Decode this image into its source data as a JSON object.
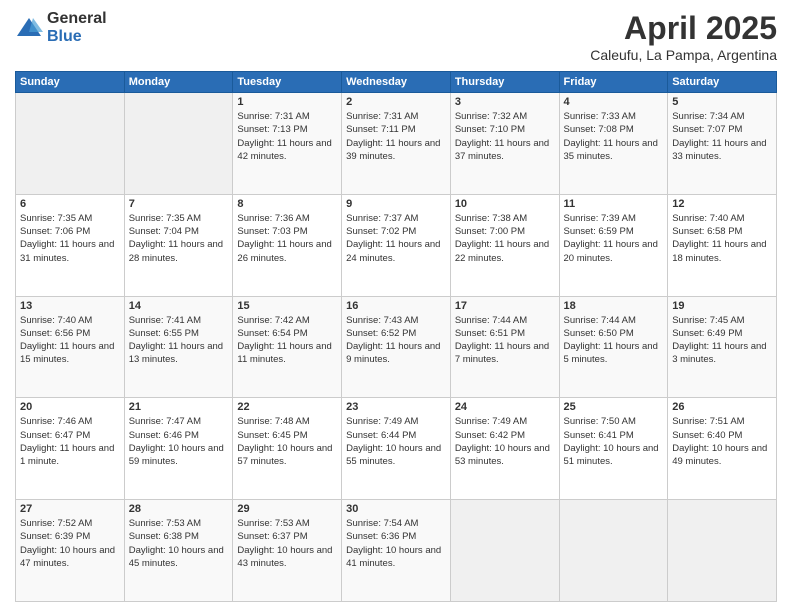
{
  "logo": {
    "general": "General",
    "blue": "Blue"
  },
  "header": {
    "month": "April 2025",
    "location": "Caleufu, La Pampa, Argentina"
  },
  "weekdays": [
    "Sunday",
    "Monday",
    "Tuesday",
    "Wednesday",
    "Thursday",
    "Friday",
    "Saturday"
  ],
  "weeks": [
    [
      null,
      null,
      {
        "day": 1,
        "sunrise": "7:31 AM",
        "sunset": "7:13 PM",
        "daylight": "11 hours and 42 minutes."
      },
      {
        "day": 2,
        "sunrise": "7:31 AM",
        "sunset": "7:11 PM",
        "daylight": "11 hours and 39 minutes."
      },
      {
        "day": 3,
        "sunrise": "7:32 AM",
        "sunset": "7:10 PM",
        "daylight": "11 hours and 37 minutes."
      },
      {
        "day": 4,
        "sunrise": "7:33 AM",
        "sunset": "7:08 PM",
        "daylight": "11 hours and 35 minutes."
      },
      {
        "day": 5,
        "sunrise": "7:34 AM",
        "sunset": "7:07 PM",
        "daylight": "11 hours and 33 minutes."
      }
    ],
    [
      {
        "day": 6,
        "sunrise": "7:35 AM",
        "sunset": "7:06 PM",
        "daylight": "11 hours and 31 minutes."
      },
      {
        "day": 7,
        "sunrise": "7:35 AM",
        "sunset": "7:04 PM",
        "daylight": "11 hours and 28 minutes."
      },
      {
        "day": 8,
        "sunrise": "7:36 AM",
        "sunset": "7:03 PM",
        "daylight": "11 hours and 26 minutes."
      },
      {
        "day": 9,
        "sunrise": "7:37 AM",
        "sunset": "7:02 PM",
        "daylight": "11 hours and 24 minutes."
      },
      {
        "day": 10,
        "sunrise": "7:38 AM",
        "sunset": "7:00 PM",
        "daylight": "11 hours and 22 minutes."
      },
      {
        "day": 11,
        "sunrise": "7:39 AM",
        "sunset": "6:59 PM",
        "daylight": "11 hours and 20 minutes."
      },
      {
        "day": 12,
        "sunrise": "7:40 AM",
        "sunset": "6:58 PM",
        "daylight": "11 hours and 18 minutes."
      }
    ],
    [
      {
        "day": 13,
        "sunrise": "7:40 AM",
        "sunset": "6:56 PM",
        "daylight": "11 hours and 15 minutes."
      },
      {
        "day": 14,
        "sunrise": "7:41 AM",
        "sunset": "6:55 PM",
        "daylight": "11 hours and 13 minutes."
      },
      {
        "day": 15,
        "sunrise": "7:42 AM",
        "sunset": "6:54 PM",
        "daylight": "11 hours and 11 minutes."
      },
      {
        "day": 16,
        "sunrise": "7:43 AM",
        "sunset": "6:52 PM",
        "daylight": "11 hours and 9 minutes."
      },
      {
        "day": 17,
        "sunrise": "7:44 AM",
        "sunset": "6:51 PM",
        "daylight": "11 hours and 7 minutes."
      },
      {
        "day": 18,
        "sunrise": "7:44 AM",
        "sunset": "6:50 PM",
        "daylight": "11 hours and 5 minutes."
      },
      {
        "day": 19,
        "sunrise": "7:45 AM",
        "sunset": "6:49 PM",
        "daylight": "11 hours and 3 minutes."
      }
    ],
    [
      {
        "day": 20,
        "sunrise": "7:46 AM",
        "sunset": "6:47 PM",
        "daylight": "11 hours and 1 minute."
      },
      {
        "day": 21,
        "sunrise": "7:47 AM",
        "sunset": "6:46 PM",
        "daylight": "10 hours and 59 minutes."
      },
      {
        "day": 22,
        "sunrise": "7:48 AM",
        "sunset": "6:45 PM",
        "daylight": "10 hours and 57 minutes."
      },
      {
        "day": 23,
        "sunrise": "7:49 AM",
        "sunset": "6:44 PM",
        "daylight": "10 hours and 55 minutes."
      },
      {
        "day": 24,
        "sunrise": "7:49 AM",
        "sunset": "6:42 PM",
        "daylight": "10 hours and 53 minutes."
      },
      {
        "day": 25,
        "sunrise": "7:50 AM",
        "sunset": "6:41 PM",
        "daylight": "10 hours and 51 minutes."
      },
      {
        "day": 26,
        "sunrise": "7:51 AM",
        "sunset": "6:40 PM",
        "daylight": "10 hours and 49 minutes."
      }
    ],
    [
      {
        "day": 27,
        "sunrise": "7:52 AM",
        "sunset": "6:39 PM",
        "daylight": "10 hours and 47 minutes."
      },
      {
        "day": 28,
        "sunrise": "7:53 AM",
        "sunset": "6:38 PM",
        "daylight": "10 hours and 45 minutes."
      },
      {
        "day": 29,
        "sunrise": "7:53 AM",
        "sunset": "6:37 PM",
        "daylight": "10 hours and 43 minutes."
      },
      {
        "day": 30,
        "sunrise": "7:54 AM",
        "sunset": "6:36 PM",
        "daylight": "10 hours and 41 minutes."
      },
      null,
      null,
      null
    ]
  ],
  "labels": {
    "sunrise": "Sunrise:",
    "sunset": "Sunset:",
    "daylight": "Daylight:"
  }
}
